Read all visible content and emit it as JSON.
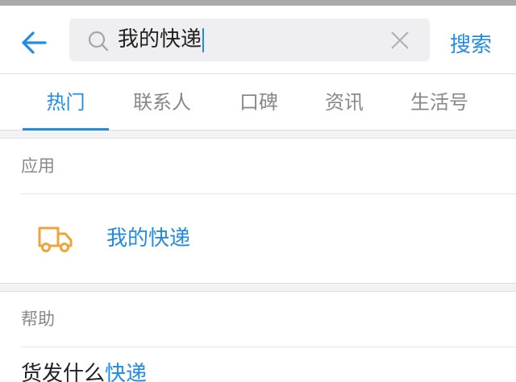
{
  "search": {
    "query": "我的快递",
    "submit_label": "搜索"
  },
  "tabs": [
    {
      "label": "热门",
      "active": true
    },
    {
      "label": "联系人",
      "active": false
    },
    {
      "label": "口碑",
      "active": false
    },
    {
      "label": "资讯",
      "active": false
    },
    {
      "label": "生活号",
      "active": false
    }
  ],
  "apps_section": {
    "title": "应用",
    "items": [
      {
        "name": "我的快递",
        "icon": "truck-icon"
      }
    ]
  },
  "help_section": {
    "title": "帮助",
    "items": [
      {
        "prefix": "货发什么",
        "highlight": "快递"
      }
    ]
  },
  "colors": {
    "accent": "#1f8de8",
    "truck_icon": "#f0a33a"
  }
}
